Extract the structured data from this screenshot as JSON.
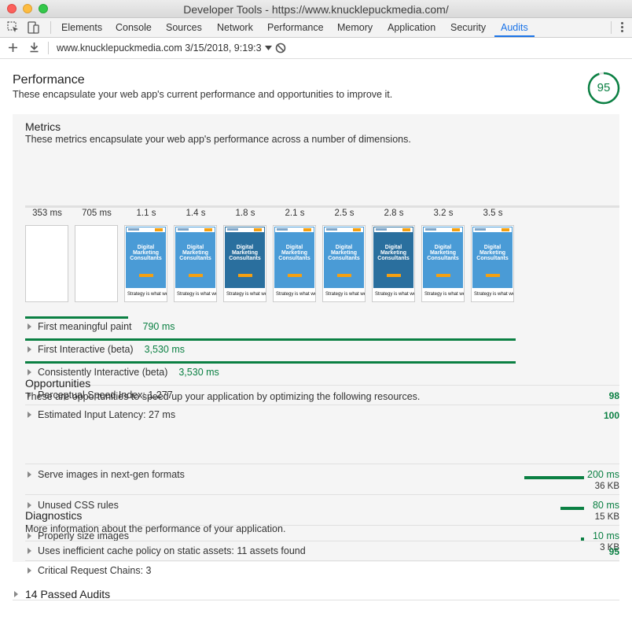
{
  "window": {
    "title": "Developer Tools - https://www.knucklepuckmedia.com/"
  },
  "tabs": [
    "Elements",
    "Console",
    "Sources",
    "Network",
    "Performance",
    "Memory",
    "Application",
    "Security",
    "Audits"
  ],
  "active_tab": "Audits",
  "toolbar": {
    "report_select": "www.knucklepuckmedia.com 3/15/2018, 9:19:3"
  },
  "icons": {
    "inspect": "inspect-element-icon",
    "device": "device-toolbar-icon",
    "add": "plus-icon",
    "download": "download-icon",
    "dropdown": "dropdown-arrow-icon",
    "clear": "block-icon",
    "more": "more-vertical-icon"
  },
  "colors": {
    "accent": "#1a73e8",
    "pass": "#0b8043"
  },
  "performance": {
    "title": "Performance",
    "description": "These encapsulate your web app's current performance and opportunities to improve it.",
    "score": "95",
    "score_fraction": 0.95
  },
  "metrics": {
    "title": "Metrics",
    "description": "These metrics encapsulate your web app's performance across a number of dimensions.",
    "filmstrip": {
      "labels": [
        "353 ms",
        "705 ms",
        "1.1 s",
        "1.4 s",
        "1.8 s",
        "2.1 s",
        "2.5 s",
        "2.8 s",
        "3.2 s",
        "3.5 s"
      ],
      "frame_title": "Digital Marketing Consultants",
      "frame_caption": "Strategy is what we do."
    },
    "items": [
      {
        "label": "First meaningful paint",
        "value": "790 ms",
        "timeline_fraction": 0.21
      },
      {
        "label": "First Interactive (beta)",
        "value": "3,530 ms",
        "timeline_fraction": 1.0
      },
      {
        "label": "Consistently Interactive (beta)",
        "value": "3,530 ms",
        "timeline_fraction": 1.0
      }
    ],
    "scored": [
      {
        "label": "Perceptual Speed Index: 1,277",
        "score": "98"
      },
      {
        "label": "Estimated Input Latency: 27 ms",
        "score": "100"
      }
    ]
  },
  "opportunities": {
    "title": "Opportunities",
    "description": "These are opportunities to speed up your application by optimizing the following resources.",
    "items": [
      {
        "label": "Serve images in next-gen formats",
        "ms": "200 ms",
        "kb": "36 KB",
        "bar_fraction": 1.0
      },
      {
        "label": "Unused CSS rules",
        "ms": "80 ms",
        "kb": "15 KB",
        "bar_fraction": 0.4
      },
      {
        "label": "Properly size images",
        "ms": "10 ms",
        "kb": "3 KB",
        "bar_fraction": 0.05
      }
    ]
  },
  "diagnostics": {
    "title": "Diagnostics",
    "description": "More information about the performance of your application.",
    "items": [
      {
        "label": "Uses inefficient cache policy on static assets: 11 assets found",
        "score": "95"
      },
      {
        "label": "Critical Request Chains: 3",
        "score": ""
      }
    ]
  },
  "passed": {
    "label": "14 Passed Audits"
  }
}
